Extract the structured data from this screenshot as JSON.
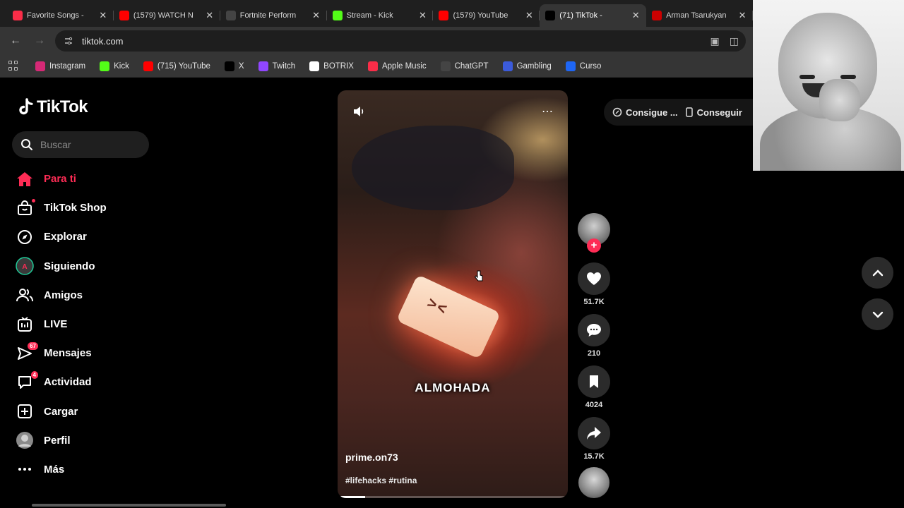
{
  "browser": {
    "tabs": [
      {
        "title": "Favorite Songs - ",
        "favicon": "apple-music-icon",
        "color": "#fa2d48",
        "active": false
      },
      {
        "title": "(1579) WATCH N",
        "favicon": "youtube-icon",
        "color": "#ff0000",
        "active": false
      },
      {
        "title": "Fortnite Perform",
        "favicon": "fortnite-icon",
        "color": "#444444",
        "active": false
      },
      {
        "title": "Stream - Kick",
        "favicon": "kick-icon",
        "color": "#53fc18",
        "active": false
      },
      {
        "title": "(1579) YouTube",
        "favicon": "youtube-icon",
        "color": "#ff0000",
        "active": false
      },
      {
        "title": "(71) TikTok - ",
        "favicon": "tiktok-icon",
        "color": "#000000",
        "active": true
      },
      {
        "title": "Arman Tsarukyan",
        "favicon": "red-site-icon",
        "color": "#cc0000",
        "active": false
      }
    ],
    "url": "tiktok.com",
    "bookmarks": [
      {
        "label": "Instagram",
        "icon": "instagram-icon",
        "color": "#d62976"
      },
      {
        "label": "Kick",
        "icon": "kick-icon",
        "color": "#53fc18"
      },
      {
        "label": "(715) YouTube",
        "icon": "youtube-icon",
        "color": "#ff0000"
      },
      {
        "label": "X",
        "icon": "x-icon",
        "color": "#000000"
      },
      {
        "label": "Twitch",
        "icon": "twitch-icon",
        "color": "#9146ff"
      },
      {
        "label": "BOTRIX",
        "icon": "botrix-icon",
        "color": "#ffffff"
      },
      {
        "label": "Apple Music",
        "icon": "apple-music-icon",
        "color": "#fa2d48"
      },
      {
        "label": "ChatGPT",
        "icon": "chatgpt-icon",
        "color": "#444444"
      },
      {
        "label": "Gambling",
        "icon": "gambling-icon",
        "color": "#3b5bdb"
      },
      {
        "label": "Curso",
        "icon": "curso-icon",
        "color": "#1e66f5"
      }
    ]
  },
  "tiktok": {
    "logo": "TikTok",
    "search_placeholder": "Buscar",
    "nav": [
      {
        "label": "Para ti",
        "icon": "home-icon",
        "active": true
      },
      {
        "label": "TikTok Shop",
        "icon": "shop-icon",
        "dot": true
      },
      {
        "label": "Explorar",
        "icon": "compass-icon"
      },
      {
        "label": "Siguiendo",
        "icon": "following-avatar-icon"
      },
      {
        "label": "Amigos",
        "icon": "friends-icon"
      },
      {
        "label": "LIVE",
        "icon": "live-icon"
      },
      {
        "label": "Mensajes",
        "icon": "messages-icon",
        "badge": "67"
      },
      {
        "label": "Actividad",
        "icon": "activity-icon",
        "badge": "4"
      },
      {
        "label": "Cargar",
        "icon": "upload-icon"
      },
      {
        "label": "Perfil",
        "icon": "profile-icon"
      },
      {
        "label": "Más",
        "icon": "more-icon"
      }
    ],
    "top_pill": {
      "item1": "Consigue ...",
      "item2": "Conseguir"
    },
    "video": {
      "caption": "ALMOHADA",
      "author": "prime.on73",
      "hashtags": "#lifehacks #rutina",
      "progress": 0.12
    },
    "actions": {
      "likes": "51.7K",
      "comments": "210",
      "saves": "4024",
      "shares": "15.7K"
    },
    "accent": "#fe2c55"
  }
}
